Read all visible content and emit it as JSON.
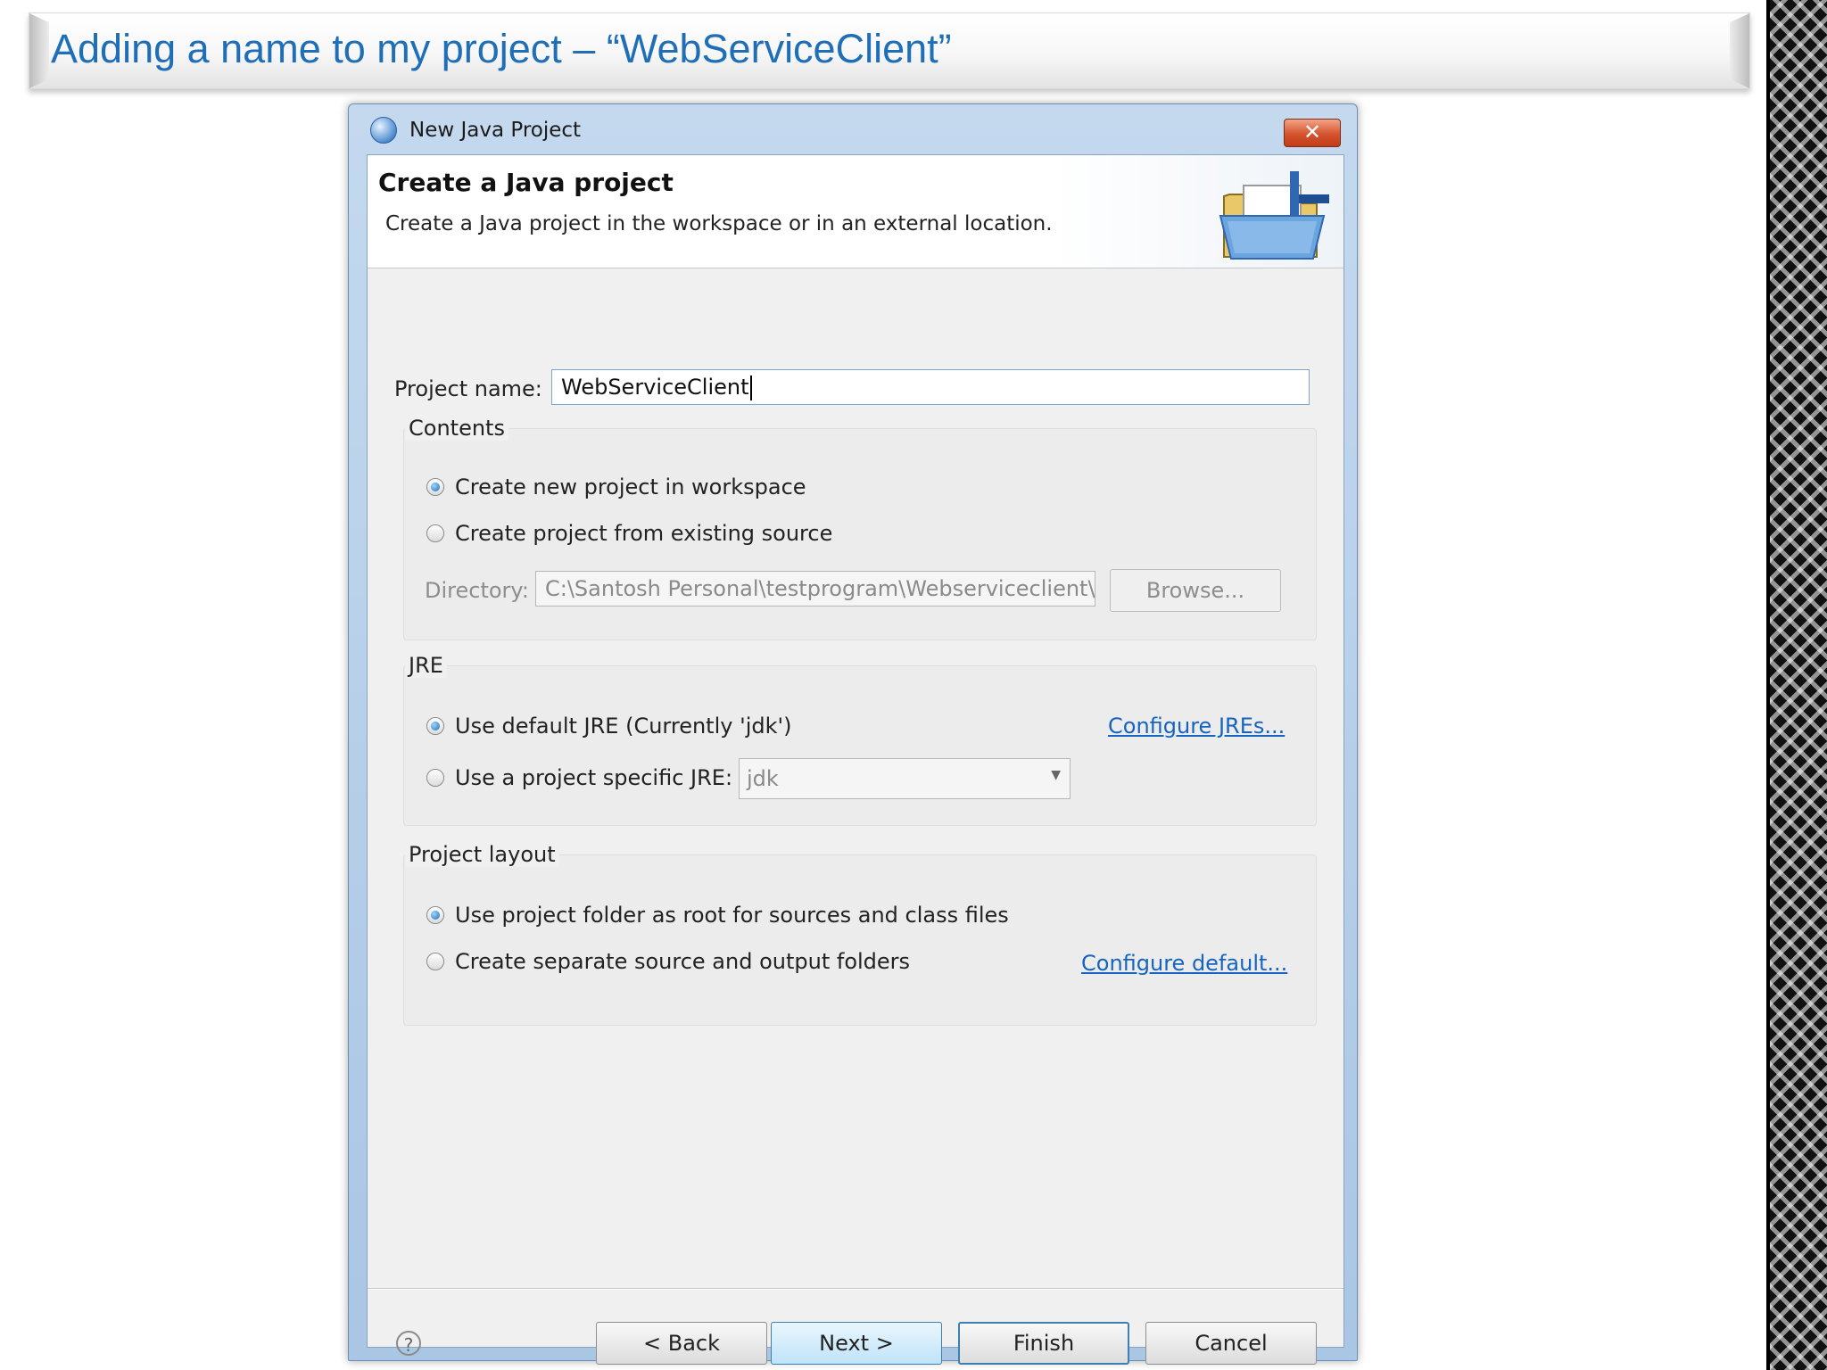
{
  "slide": {
    "title": "Adding a name to my project – “WebServiceClient”"
  },
  "dialog": {
    "window_title": "New Java Project",
    "header_title": "Create a Java project",
    "header_description": "Create a Java project in the workspace or in an external location.",
    "project_name_label": "Project name:",
    "project_name_value": "WebServiceClient",
    "contents": {
      "label": "Contents",
      "option_new": "Create new project in workspace",
      "option_existing": "Create project from existing source",
      "directory_label": "Directory:",
      "directory_value": "C:\\Santosh Personal\\testprogram\\Webserviceclient\\W",
      "browse_label": "Browse..."
    },
    "jre": {
      "label": "JRE",
      "option_default": "Use default JRE (Currently 'jdk')",
      "option_specific": "Use a project specific JRE:",
      "specific_value": "jdk",
      "configure_link": "Configure JREs..."
    },
    "layout": {
      "label": "Project layout",
      "option_root": "Use project folder as root for sources and class files",
      "option_separate": "Create separate source and output folders",
      "configure_link": "Configure default..."
    },
    "buttons": {
      "help": "?",
      "back": "< Back",
      "next": "Next >",
      "finish": "Finish",
      "cancel": "Cancel",
      "close": "✕"
    }
  },
  "colors": {
    "slide_title": "#1f6fb8",
    "link": "#1565c0",
    "close_button": "#d5532e"
  }
}
